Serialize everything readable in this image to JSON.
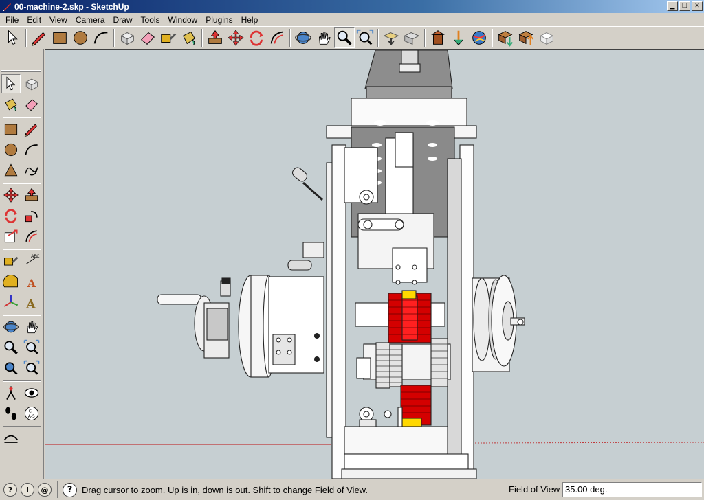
{
  "window": {
    "title": "00-machine-2.skp - SketchUp"
  },
  "menu": [
    "File",
    "Edit",
    "View",
    "Camera",
    "Draw",
    "Tools",
    "Window",
    "Plugins",
    "Help"
  ],
  "toolbar": {
    "items": [
      {
        "name": "select-tool",
        "icon": "arrow-icon"
      },
      {
        "sep": true
      },
      {
        "name": "pencil-tool",
        "icon": "pencil-icon"
      },
      {
        "name": "rectangle-tool",
        "icon": "rectangle-icon"
      },
      {
        "name": "circle-tool",
        "icon": "circle-icon"
      },
      {
        "name": "arc-tool",
        "icon": "arc-icon"
      },
      {
        "sep": true
      },
      {
        "name": "make-component-tool",
        "icon": "component-icon"
      },
      {
        "name": "eraser-tool",
        "icon": "eraser-icon"
      },
      {
        "name": "tape-measure-tool",
        "icon": "tape-icon"
      },
      {
        "name": "paint-bucket-tool",
        "icon": "bucket-icon"
      },
      {
        "sep": true
      },
      {
        "name": "push-pull-tool",
        "icon": "pushpull-icon"
      },
      {
        "name": "move-tool",
        "icon": "move-icon"
      },
      {
        "name": "rotate-tool",
        "icon": "rotate-icon"
      },
      {
        "name": "offset-tool",
        "icon": "offset-icon"
      },
      {
        "sep": true
      },
      {
        "name": "orbit-tool",
        "icon": "orbit-icon"
      },
      {
        "name": "pan-tool",
        "icon": "hand-icon"
      },
      {
        "name": "zoom-tool",
        "icon": "magnifier-icon",
        "active": true
      },
      {
        "name": "zoom-extents-tool",
        "icon": "zoom-extents-icon"
      },
      {
        "sep": true
      },
      {
        "name": "previous-view-tool",
        "icon": "previous-icon"
      },
      {
        "name": "next-view-tool",
        "icon": "next-icon"
      },
      {
        "sep": true
      },
      {
        "name": "warehouse-tool",
        "icon": "warehouse-icon"
      },
      {
        "name": "share-model-tool",
        "icon": "share-icon"
      },
      {
        "name": "google-earth-tool",
        "icon": "globe-icon"
      },
      {
        "sep": true
      },
      {
        "name": "get-models-tool",
        "icon": "get-models-icon"
      },
      {
        "name": "share-component-tool",
        "icon": "share-component-icon"
      },
      {
        "name": "extension-tool",
        "icon": "box-icon"
      }
    ]
  },
  "left_tools": [
    [
      "select",
      "make-component"
    ],
    [
      "paint-bucket",
      "eraser"
    ],
    [
      "rectangle",
      "line"
    ],
    [
      "circle",
      "arc"
    ],
    [
      "polygon",
      "freehand"
    ],
    [
      "move",
      "push-pull"
    ],
    [
      "rotate",
      "follow-me"
    ],
    [
      "scale",
      "offset"
    ],
    [
      "tape-measure",
      "dimension"
    ],
    [
      "protractor",
      "text"
    ],
    [
      "axes",
      "3d-text"
    ],
    [
      "orbit",
      "pan"
    ],
    [
      "zoom",
      "zoom-window"
    ],
    [
      "previous",
      "zoom-extents"
    ],
    [
      "position-camera",
      "look-around"
    ],
    [
      "walk",
      "section-plane"
    ],
    [
      "sandbox"
    ]
  ],
  "status": {
    "hint": "Drag cursor to zoom.  Up is in, down is out. Shift to change Field of View.",
    "vcb_label": "Field of View",
    "vcb_value": "35.00 deg.",
    "icons": [
      "geo-location-icon",
      "credits-icon",
      "help-circle-icon"
    ]
  },
  "colors": {
    "viewport_bg": "#c6cfd2",
    "gear_red": "#d00000",
    "accent_yellow": "#ffd800"
  }
}
